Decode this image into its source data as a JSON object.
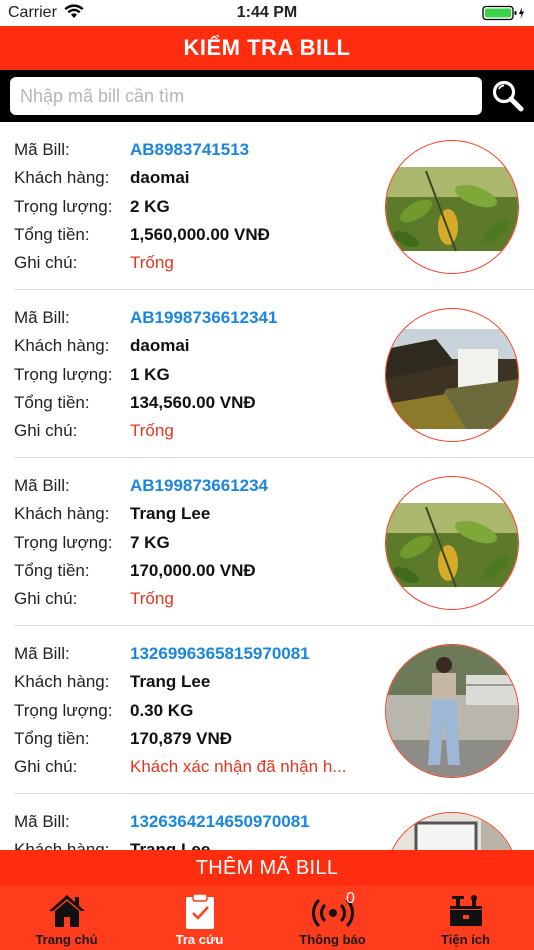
{
  "status_bar": {
    "carrier": "Carrier",
    "time": "1:44 PM"
  },
  "header": {
    "title": "KIỂM TRA BILL"
  },
  "search": {
    "placeholder": "Nhập mã bill cần tìm"
  },
  "labels": {
    "code": "Mã Bill:",
    "customer": "Khách hàng:",
    "weight": "Trọng lượng:",
    "total": "Tổng tiền:",
    "note": "Ghi chú:"
  },
  "bills": [
    {
      "code": "AB8983741513",
      "customer": "daomai",
      "weight": "2 KG",
      "total": "1,560,000.00 VNĐ",
      "note": "Trống",
      "image": "leaves"
    },
    {
      "code": "AB1998736612341",
      "customer": "daomai",
      "weight": "1 KG",
      "total": "134,560.00 VNĐ",
      "note": "Trống",
      "image": "waterfall"
    },
    {
      "code": "AB199873661234",
      "customer": "Trang Lee",
      "weight": "7 KG",
      "total": "170,000.00 VNĐ",
      "note": "Trống",
      "image": "leaves"
    },
    {
      "code": "1326996365815970081",
      "customer": "Trang Lee",
      "weight": "0.30 KG",
      "total": "170,879 VNĐ",
      "note": "Khách xác nhận đã nhận h...",
      "image": "fashion-photo"
    },
    {
      "code": "1326364214650970081",
      "customer": "Trang Lee",
      "weight": "",
      "total": "",
      "note": "",
      "image": "door"
    }
  ],
  "add_button": {
    "label": "THÊM MÃ BILL"
  },
  "tabs": [
    {
      "label": "Trang chủ",
      "icon": "home-icon"
    },
    {
      "label": "Tra cứu",
      "icon": "clipboard-check-icon"
    },
    {
      "label": "Thông báo",
      "icon": "broadcast-icon",
      "badge": "0"
    },
    {
      "label": "Tiện ích",
      "icon": "toolbox-icon"
    }
  ],
  "colors": {
    "accent": "#ff2d10",
    "link": "#1a86e0",
    "note": "#e8341c"
  }
}
